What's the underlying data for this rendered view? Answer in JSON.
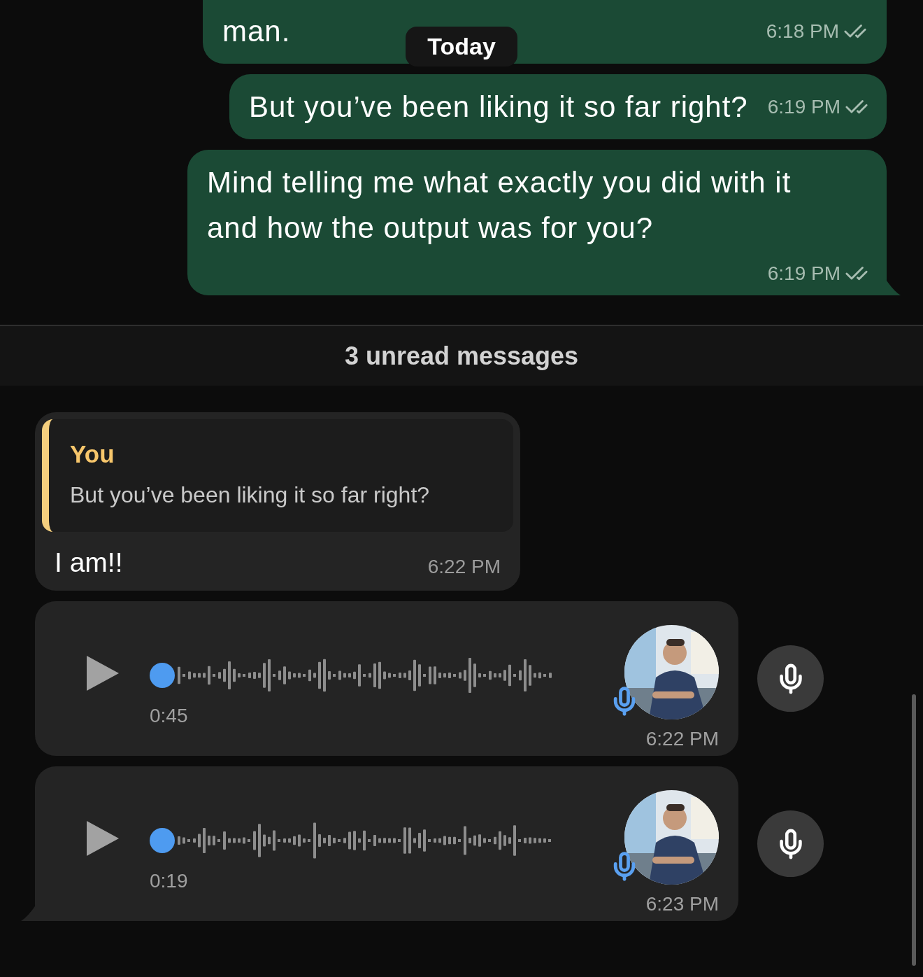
{
  "date_chip": "Today",
  "outgoing": [
    {
      "text": "man.",
      "time": "6:18 PM",
      "read": false
    },
    {
      "text": "But you’ve been liking it so far right?",
      "time": "6:19 PM",
      "read": false
    },
    {
      "text": "Mind telling me what exactly you did with it and how the output was for you?",
      "time": "6:19 PM",
      "read": false
    }
  ],
  "unread_banner": "3 unread messages",
  "incoming": [
    {
      "kind": "text",
      "quote": {
        "author": "You",
        "text": "But you’ve been liking it so far right?"
      },
      "text": "I am!!",
      "time": "6:22 PM"
    },
    {
      "kind": "voice",
      "duration": "0:45",
      "time": "6:22 PM"
    },
    {
      "kind": "voice",
      "duration": "0:19",
      "time": "6:23 PM"
    }
  ]
}
